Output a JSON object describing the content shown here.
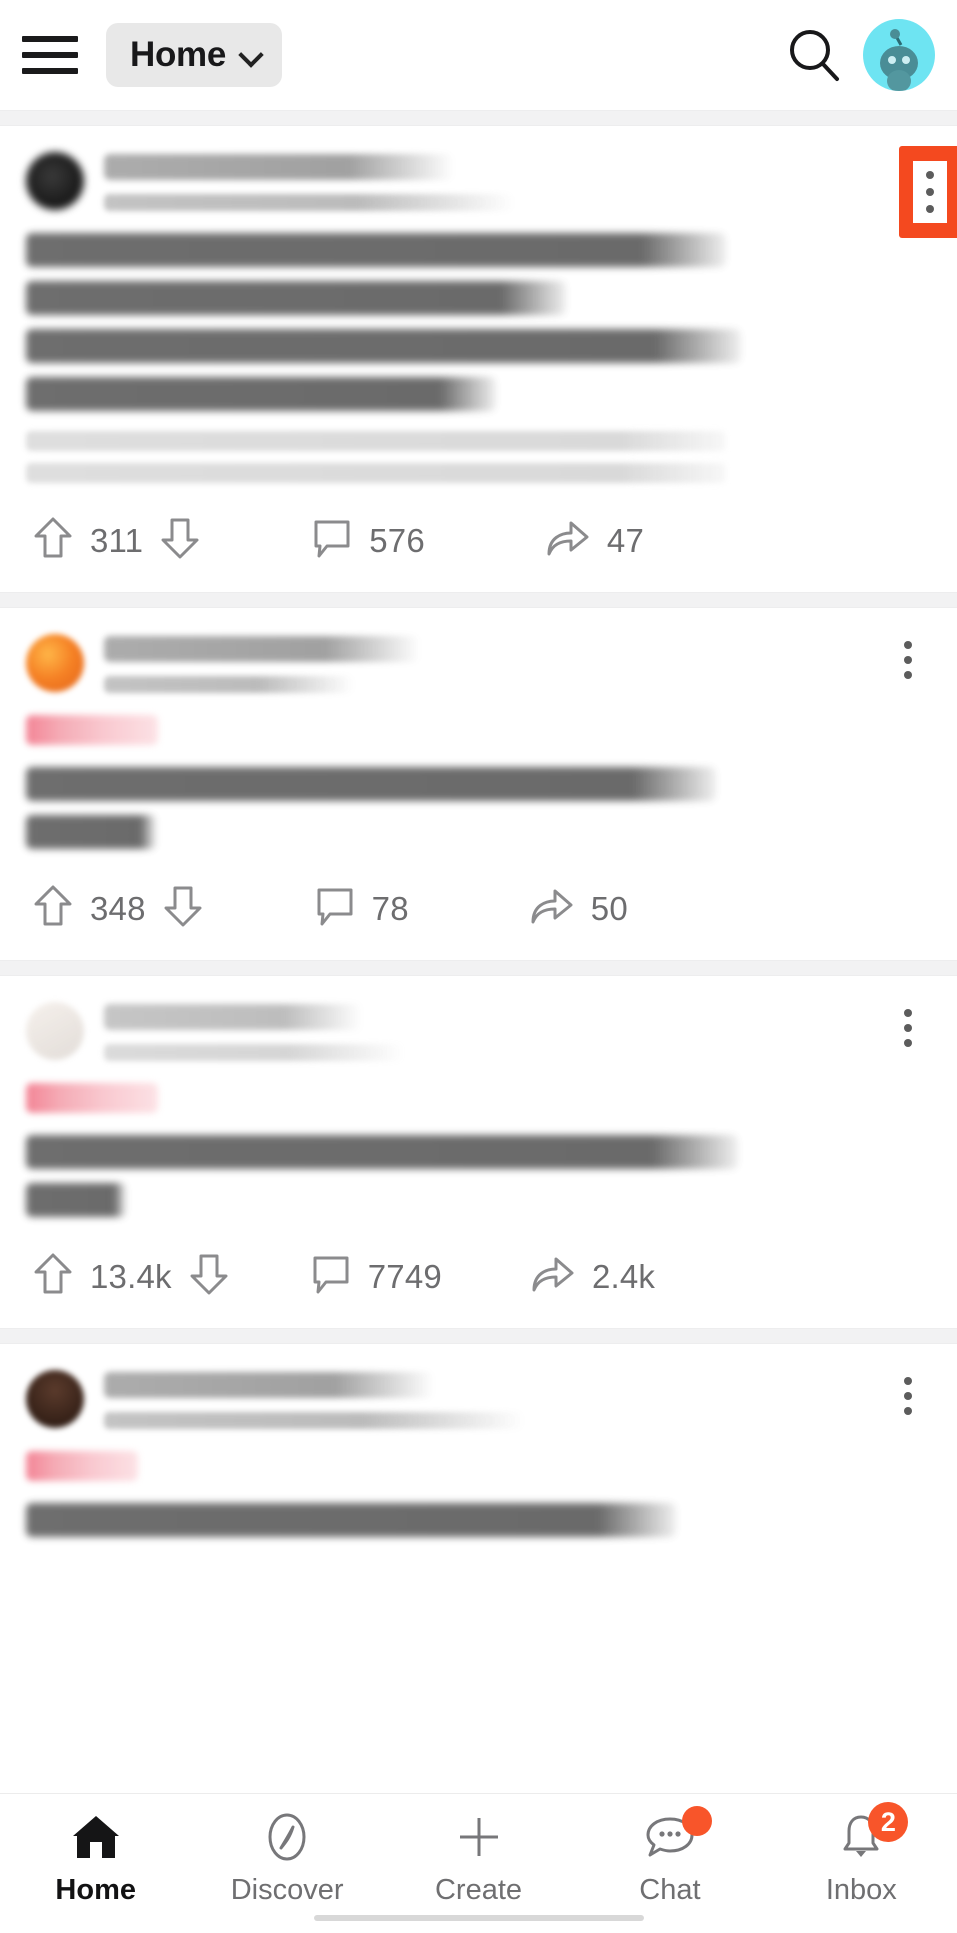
{
  "app": {
    "name": "Reddit",
    "accent_color": "#f8552a",
    "highlight_color": "#f4491f",
    "background": "#ffffff",
    "separator_color": "#f2f2f3"
  },
  "header": {
    "menu_icon": "hamburger-icon",
    "feed_selector": {
      "label": "Home",
      "chevron": "chevron-down-icon"
    },
    "search_icon": "search-icon",
    "avatar": {
      "name": "user-avatar",
      "background": "#6ee4f2"
    }
  },
  "feed": {
    "posts": [
      {
        "id": "post-1",
        "avatar_style": "dark",
        "subreddit": "",
        "byline": "",
        "nsfw": false,
        "title_lines": 4,
        "body_lines": 2,
        "highlighted_menu": true,
        "actions": {
          "upvote_icon": "upvote-arrow-icon",
          "score": "311",
          "downvote_icon": "downvote-arrow-icon",
          "comment_icon": "comment-bubble-icon",
          "comments": "576",
          "share_icon": "share-arrow-icon",
          "shares": "47"
        }
      },
      {
        "id": "post-2",
        "avatar_style": "orange",
        "subreddit": "",
        "byline": "",
        "nsfw": true,
        "title_lines": 2,
        "body_lines": 0,
        "highlighted_menu": false,
        "actions": {
          "upvote_icon": "upvote-arrow-icon",
          "score": "348",
          "downvote_icon": "downvote-arrow-icon",
          "comment_icon": "comment-bubble-icon",
          "comments": "78",
          "share_icon": "share-arrow-icon",
          "shares": "50"
        }
      },
      {
        "id": "post-3",
        "avatar_style": "pale",
        "subreddit": "",
        "byline": "",
        "nsfw": true,
        "title_lines": 2,
        "body_lines": 0,
        "highlighted_menu": false,
        "actions": {
          "upvote_icon": "upvote-arrow-icon",
          "score": "13.4k",
          "downvote_icon": "downvote-arrow-icon",
          "comment_icon": "comment-bubble-icon",
          "comments": "7749",
          "share_icon": "share-arrow-icon",
          "shares": "2.4k"
        }
      },
      {
        "id": "post-4",
        "avatar_style": "photo",
        "subreddit": "",
        "byline": "",
        "nsfw": true,
        "title_lines": 1,
        "body_lines": 0,
        "highlighted_menu": false,
        "actions": null
      }
    ]
  },
  "bottom_nav": {
    "items": [
      {
        "label": "Home",
        "icon": "home-icon",
        "active": true,
        "badge": null
      },
      {
        "label": "Discover",
        "icon": "compass-icon",
        "active": false,
        "badge": null
      },
      {
        "label": "Create",
        "icon": "plus-icon",
        "active": false,
        "badge": null
      },
      {
        "label": "Chat",
        "icon": "chat-bubble-icon",
        "active": false,
        "badge": "dot"
      },
      {
        "label": "Inbox",
        "icon": "bell-icon",
        "active": false,
        "badge": "2"
      }
    ]
  }
}
